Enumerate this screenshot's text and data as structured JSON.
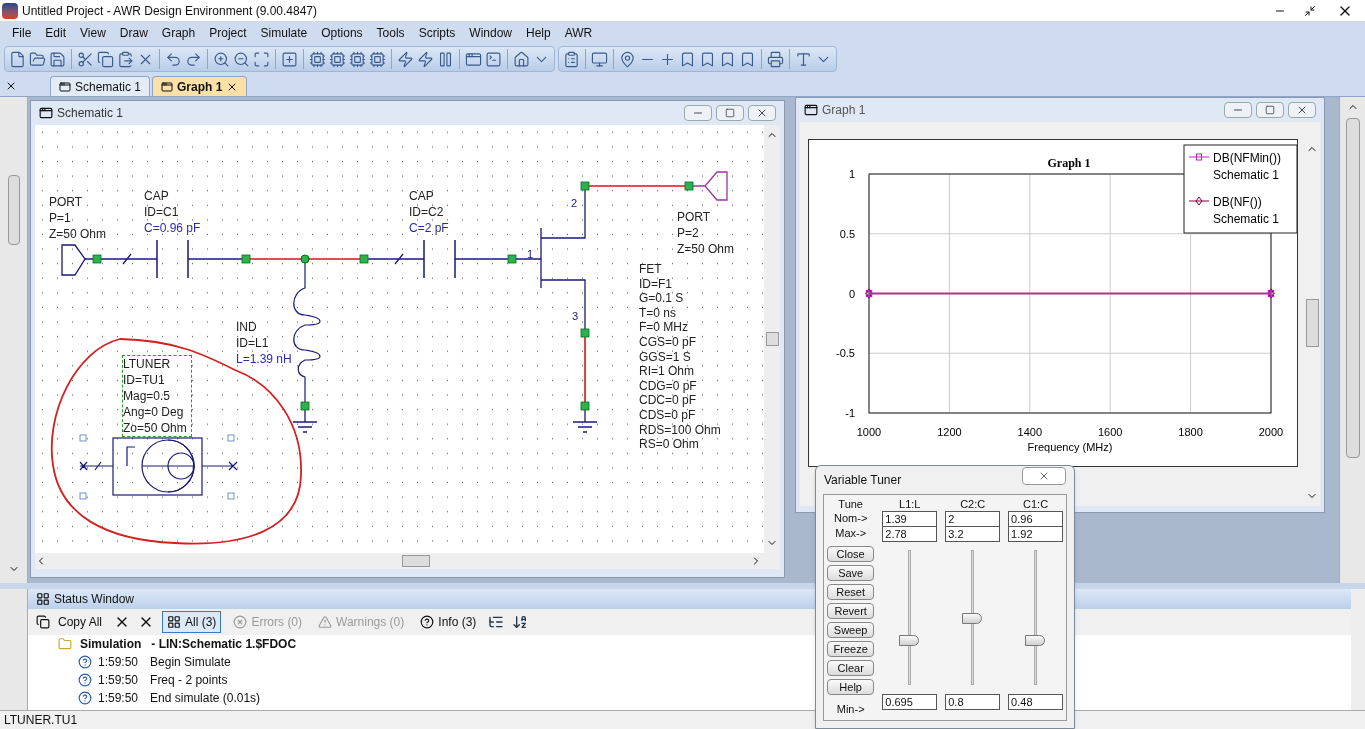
{
  "window": {
    "title": "Untitled Project - AWR Design Environment (9.00.4847)"
  },
  "menu": [
    "File",
    "Edit",
    "View",
    "Draw",
    "Graph",
    "Project",
    "Simulate",
    "Options",
    "Tools",
    "Scripts",
    "Window",
    "Help",
    "AWR"
  ],
  "tabs": [
    {
      "label": "Schematic 1",
      "selected": false
    },
    {
      "label": "Graph 1",
      "selected": true
    }
  ],
  "schematic_window": {
    "title": "Schematic 1",
    "elements": [
      {
        "kind": "port",
        "labels": [
          {
            "text": "PORT",
            "tuned": false
          },
          {
            "text": "P=1",
            "tuned": false
          },
          {
            "text": "Z=50 Ohm",
            "tuned": false
          }
        ]
      },
      {
        "kind": "cap",
        "labels": [
          {
            "text": "CAP",
            "tuned": false
          },
          {
            "text": "ID=C1",
            "tuned": false
          },
          {
            "text": "C=0.96 pF",
            "tuned": true
          }
        ]
      },
      {
        "kind": "cap",
        "labels": [
          {
            "text": "CAP",
            "tuned": false
          },
          {
            "text": "ID=C2",
            "tuned": false
          },
          {
            "text": "C=2 pF",
            "tuned": true
          }
        ]
      },
      {
        "kind": "ind",
        "labels": [
          {
            "text": "IND",
            "tuned": false
          },
          {
            "text": "ID=L1",
            "tuned": false
          },
          {
            "text": "L=1.39 nH",
            "tuned": true
          }
        ]
      },
      {
        "kind": "port",
        "labels": [
          {
            "text": "PORT",
            "tuned": false
          },
          {
            "text": "P=2",
            "tuned": false
          },
          {
            "text": "Z=50 Ohm",
            "tuned": false
          }
        ]
      },
      {
        "kind": "fet",
        "labels": [
          {
            "text": "FET",
            "tuned": false
          },
          {
            "text": "ID=F1",
            "tuned": false
          },
          {
            "text": "G=0.1 S",
            "tuned": false
          },
          {
            "text": "T=0 ns",
            "tuned": false
          },
          {
            "text": "F=0 MHz",
            "tuned": false
          },
          {
            "text": "CGS=0 pF",
            "tuned": false
          },
          {
            "text": "GGS=1 S",
            "tuned": false
          },
          {
            "text": "RI=1 Ohm",
            "tuned": false
          },
          {
            "text": "CDG=0 pF",
            "tuned": false
          },
          {
            "text": "CDC=0 pF",
            "tuned": false
          },
          {
            "text": "CDS=0 pF",
            "tuned": false
          },
          {
            "text": "RDS=100 Ohm",
            "tuned": false
          },
          {
            "text": "RS=0 Ohm",
            "tuned": false
          }
        ]
      },
      {
        "kind": "tuner",
        "selected": true,
        "labels": [
          {
            "text": "LTUNER",
            "tuned": false
          },
          {
            "text": "ID=TU1",
            "tuned": false
          },
          {
            "text": "Mag=0.5",
            "tuned": false
          },
          {
            "text": "Ang=0 Deg",
            "tuned": false
          },
          {
            "text": "Zo=50 Ohm",
            "tuned": false
          }
        ]
      }
    ],
    "pins": [
      "1",
      "2",
      "3"
    ]
  },
  "graph_window": {
    "title": "Graph 1",
    "legend_sources": [
      "Schematic 1",
      "Schematic 1"
    ],
    "chart_data": {
      "type": "line",
      "title": "Graph 1",
      "xlabel": "Frequency (MHz)",
      "x": [
        1000,
        2000
      ],
      "series": [
        {
          "name": "DB(NFMin())",
          "color": "#c020c0",
          "marker": "square",
          "values": [
            0,
            0
          ]
        },
        {
          "name": "DB(NF())",
          "color": "#800040",
          "marker": "diamond",
          "values": [
            0,
            0
          ]
        }
      ],
      "xlim": [
        1000,
        2000
      ],
      "ylim": [
        -1,
        1
      ],
      "xticks": [
        1000,
        1200,
        1400,
        1600,
        1800,
        2000
      ],
      "yticks": [
        -1,
        -0.5,
        0,
        0.5,
        1
      ],
      "grid": true,
      "legend": true
    }
  },
  "tuner": {
    "title": "Variable Tuner",
    "tune_label": "Tune",
    "nom_label": "Nom->",
    "max_label": "Max->",
    "min_label": "Min->",
    "buttons": [
      "Close",
      "Save",
      "Reset",
      "Revert",
      "Sweep",
      "Freeze",
      "Clear",
      "Help"
    ],
    "columns": [
      {
        "name": "L1:L",
        "nom": "1.39",
        "max": "2.78",
        "min": "0.695",
        "level": 0.333
      },
      {
        "name": "C2:C",
        "nom": "2",
        "max": "3.2",
        "min": "0.8",
        "level": 0.5
      },
      {
        "name": "C1:C",
        "nom": "0.96",
        "max": "1.92",
        "min": "0.48",
        "level": 0.333
      }
    ]
  },
  "status_window": {
    "title": "Status Window",
    "copy_label": "Copy All",
    "filters": [
      {
        "label": "All (3)",
        "selected": true,
        "disabled": false
      },
      {
        "label": "Errors (0)",
        "selected": false,
        "disabled": true
      },
      {
        "label": "Warnings (0)",
        "selected": false,
        "disabled": true
      },
      {
        "label": "Info (3)",
        "selected": false,
        "disabled": false
      }
    ],
    "group": {
      "name": "Simulation",
      "detail": "- LIN:Schematic 1.$FDOC",
      "entries": [
        {
          "time": "1:59:50",
          "message": "Begin Simulate"
        },
        {
          "time": "1:59:50",
          "message": "Freq - 2 points"
        },
        {
          "time": "1:59:50",
          "message": "End simulate (0.01s)"
        }
      ]
    }
  },
  "status_bar": "LTUNER.TU1"
}
